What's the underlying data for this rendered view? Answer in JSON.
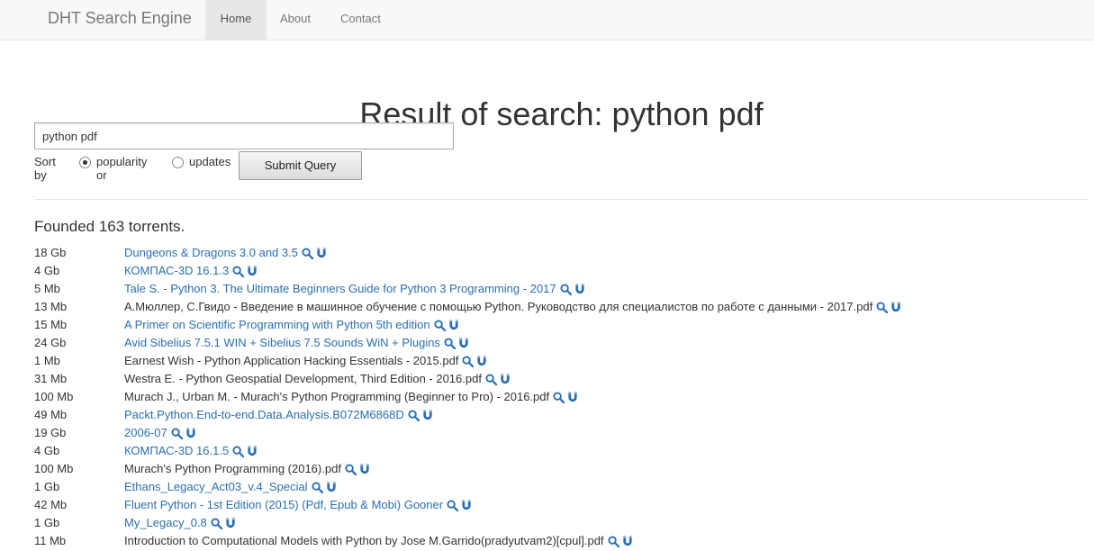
{
  "nav": {
    "brand": "DHT Search Engine",
    "items": [
      "Home",
      "About",
      "Contact"
    ]
  },
  "page": {
    "title": "Result of search: python pdf",
    "search_value": "python pdf",
    "sort_by_label": "Sort by",
    "option_popularity": "popularity or",
    "option_updates": "updates",
    "submit_label": "Submit Query",
    "found_text": "Founded 163 torrents."
  },
  "results": [
    {
      "size": "18 Gb",
      "name": "Dungeons & Dragons 3.0 and 3.5",
      "link": true
    },
    {
      "size": "4 Gb",
      "name": "КОМПАС-3D 16.1.3",
      "link": true
    },
    {
      "size": "5 Mb",
      "name": "Tale S. - Python 3. The Ultimate Beginners Guide for Python 3 Programming - 2017",
      "link": true
    },
    {
      "size": "13 Mb",
      "name": "А.Мюллер, С.Гвидо - Введение в машинное обучение с помощью Python. Руководство для специалистов по работе с данными - 2017.pdf",
      "link": false
    },
    {
      "size": "15 Mb",
      "name": "A Primer on Scientific Programming with Python 5th edition",
      "link": true
    },
    {
      "size": "24 Gb",
      "name": "Avid Sibelius 7.5.1 WIN + Sibelius 7.5 Sounds WiN + Plugins",
      "link": true
    },
    {
      "size": "1 Mb",
      "name": "Earnest Wish - Python Application Hacking Essentials - 2015.pdf",
      "link": false
    },
    {
      "size": "31 Mb",
      "name": "Westra E. - Python Geospatial Development, Third Edition - 2016.pdf",
      "link": false
    },
    {
      "size": "100 Mb",
      "name": "Murach J., Urban M. - Murach's Python Programming (Beginner to Pro) - 2016.pdf",
      "link": false
    },
    {
      "size": "49 Mb",
      "name": "Packt.Python.End-to-end.Data.Analysis.B072M6868D",
      "link": true
    },
    {
      "size": "19 Gb",
      "name": "2006-07",
      "link": true
    },
    {
      "size": "4 Gb",
      "name": "КОМПАС-3D 16.1.5",
      "link": true
    },
    {
      "size": "100 Mb",
      "name": "Murach's Python Programming (2016).pdf",
      "link": false
    },
    {
      "size": "1 Gb",
      "name": "Ethans_Legacy_Act03_v.4_Special",
      "link": true
    },
    {
      "size": "42 Mb",
      "name": "Fluent Python - 1st Edition (2015) (Pdf, Epub & Mobi) Gooner",
      "link": true
    },
    {
      "size": "1 Gb",
      "name": "My_Legacy_0.8",
      "link": true
    },
    {
      "size": "11 Mb",
      "name": "Introduction to Computational Models with Python by Jose M.Garrido(pradyutvam2)[cpul].pdf",
      "link": false
    }
  ],
  "colors": {
    "link": "#2a6fb1",
    "icon": "#2a6fb1"
  },
  "icons": {
    "details": "search-icon",
    "magnet": "magnet-icon"
  }
}
